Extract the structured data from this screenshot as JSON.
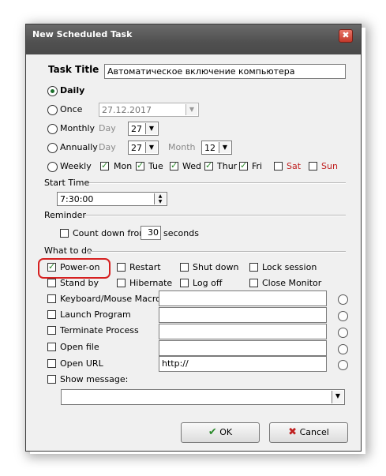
{
  "window": {
    "title": "New Scheduled Task",
    "close_glyph": "✖"
  },
  "task_title": {
    "label": "Task Title",
    "value": "Автоматическое включение компьютера"
  },
  "schedule": {
    "daily": "Daily",
    "once": {
      "label": "Once",
      "date": "27.12.2017"
    },
    "monthly": {
      "label": "Monthly",
      "day_label": "Day",
      "day": "27"
    },
    "annually": {
      "label": "Annually",
      "day_label": "Day",
      "day": "27",
      "month_label": "Month",
      "month": "12"
    },
    "weekly": {
      "label": "Weekly",
      "days": [
        "Mon",
        "Tue",
        "Wed",
        "Thur",
        "Fri",
        "Sat",
        "Sun"
      ]
    }
  },
  "start_time": {
    "label": "Start Time",
    "value": "7:30:00"
  },
  "reminder": {
    "label": "Reminder",
    "count_down": "Count down from",
    "seconds_value": "30",
    "seconds": "seconds"
  },
  "what_to_do": {
    "label": "What to do",
    "power_on": "Power-on",
    "restart": "Restart",
    "shut_down": "Shut down",
    "lock_session": "Lock session",
    "stand_by": "Stand by",
    "hibernate": "Hibernate",
    "log_off": "Log off",
    "close_monitor": "Close Monitor",
    "keyboard_macro": "Keyboard/Mouse Macro",
    "launch_program": "Launch Program",
    "terminate_process": "Terminate Process",
    "open_file": "Open file",
    "open_url": "Open URL",
    "url_value": "http://",
    "show_message": "Show message:"
  },
  "buttons": {
    "ok": "OK",
    "cancel": "Cancel"
  },
  "colors": {
    "accent_green": "#2a8a2a",
    "weekend_red": "#c02020",
    "highlight_red": "#d62020"
  }
}
